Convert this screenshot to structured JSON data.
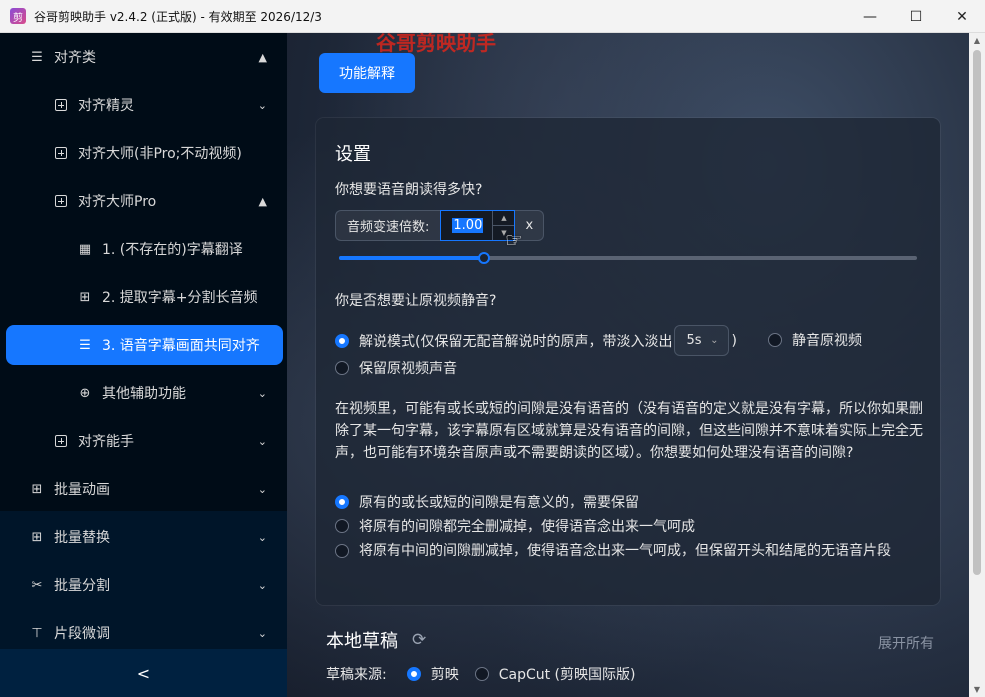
{
  "window": {
    "title": "谷哥剪映助手 v2.4.2 (正式版) - 有效期至 2026/12/3"
  },
  "sidebar": {
    "items": [
      {
        "label": "对齐类",
        "icon": "align-icon"
      },
      {
        "label": "对齐精灵",
        "icon": "plus-square-icon"
      },
      {
        "label": "对齐大师(非Pro;不动视频)",
        "icon": "plus-square-icon"
      },
      {
        "label": "对齐大师Pro",
        "icon": "plus-square-icon"
      },
      {
        "label": "1. (不存在的)字幕翻译",
        "icon": "image-translate-icon"
      },
      {
        "label": "2. 提取字幕+分割长音频",
        "icon": "split-icon"
      },
      {
        "label": "3. 语音字幕画面共同对齐",
        "icon": "align-icon"
      },
      {
        "label": "其他辅助功能",
        "icon": "plus-circle-icon"
      },
      {
        "label": "对齐能手",
        "icon": "plus-square-icon"
      },
      {
        "label": "批量动画",
        "icon": "grid-icon"
      },
      {
        "label": "批量替换",
        "icon": "grid-icon"
      },
      {
        "label": "批量分割",
        "icon": "scissors-icon"
      },
      {
        "label": "片段微调",
        "icon": "paperclip-icon"
      }
    ],
    "collapse_label": "<"
  },
  "main": {
    "watermark": "谷哥剪映助手",
    "explain_button": "功能解释",
    "settings": {
      "title": "设置",
      "speed_question": "你想要语音朗读得多快?",
      "speed_label": "音频变速倍数:",
      "speed_value": "1.00",
      "speed_suffix": "x",
      "speed_slider_fraction": 0.25,
      "mute_question": "你是否想要让原视频静音?",
      "mute_option1_prefix": "解说模式(仅保留无配音解说时的原声，带淡入淡出",
      "fade_value": "5s",
      "mute_option1_suffix": ")",
      "mute_option2": "静音原视频",
      "mute_option3": "保留原视频声音",
      "gap_question": "在视频里，可能有或长或短的间隙是没有语音的（没有语音的定义就是没有字幕，所以你如果删除了某一句字幕，该字幕原有区域就算是没有语音的间隙，但这些间隙并不意味着实际上完全无声，也可能有环境杂音原声或不需要朗读的区域）。你想要如何处理没有语音的间隙?",
      "gap_option1": "原有的或长或短的间隙是有意义的，需要保留",
      "gap_option2": "将原有的间隙都完全删减掉，使得语音念出来一气呵成",
      "gap_option3": "将原有中间的间隙删减掉，使得语音念出来一气呵成，但保留开头和结尾的无语音片段"
    },
    "drafts": {
      "title": "本地草稿",
      "expand_all": "展开所有",
      "source_label": "草稿来源:",
      "source_option1": "剪映",
      "source_option2": "CapCut (剪映国际版)"
    }
  },
  "colors": {
    "accent": "#1677ff",
    "sidebar_bg": "#001529"
  }
}
